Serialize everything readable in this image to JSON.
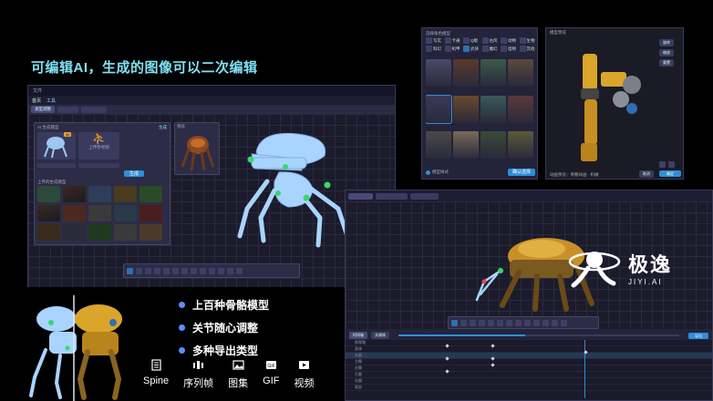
{
  "headline": "可编辑AI，生成的图像可以二次编辑",
  "features": [
    "上百种骨骼模型",
    "关节随心调整",
    "多种导出类型"
  ],
  "export_types": [
    {
      "label": "Spine",
      "icon": "spine-icon"
    },
    {
      "label": "序列帧",
      "icon": "frames-icon"
    },
    {
      "label": "图集",
      "icon": "atlas-icon"
    },
    {
      "label": "GIF",
      "icon": "gif-icon"
    },
    {
      "label": "视频",
      "icon": "video-icon"
    }
  ],
  "brand": {
    "name": "极逸",
    "sub": "JIYI.AI"
  },
  "editor_main": {
    "title": "文件",
    "menu": [
      "首页",
      "工具"
    ],
    "tab_label": "发型调整",
    "left_panel_title": "AI 生成模型",
    "left_panel_btn": "生成",
    "section_label": "上传的生成模型",
    "label_ai": "AI",
    "label_upload": "上传参考图",
    "generate_btn": "生成",
    "preview_label": "预览"
  },
  "character_picker": {
    "title": "选择角色模型",
    "categories": [
      "写实",
      "卡通",
      "Q版",
      "古风",
      "动物",
      "生物",
      "科幻",
      "机甲",
      "武侠",
      "魔幻",
      "怪物",
      "其他"
    ],
    "bottom_label": "模型样式",
    "confirm": "确认选择"
  },
  "preview_window": {
    "title": "模型预览",
    "side_buttons": [
      "旋转",
      "缩放",
      "重置"
    ],
    "footer": "动画预览：骨骼动画 · 机械",
    "cancel": "取消",
    "ok": "确定"
  },
  "editor_bottom": {
    "tabs": [
      "时间轴",
      "骨骼编辑",
      "图层"
    ],
    "timeline_tabs": [
      "时间轴",
      "关键帧"
    ],
    "tracks": [
      "根骨骼",
      "身体",
      "头部",
      "左臂",
      "右臂",
      "左腿",
      "右腿",
      "尾部"
    ],
    "right_btn": "导出"
  },
  "colors": {
    "accent": "#7fe0f4",
    "bone": "#a9d4ff",
    "joint": "#39d86a",
    "bullet": "#5b8ff9"
  }
}
